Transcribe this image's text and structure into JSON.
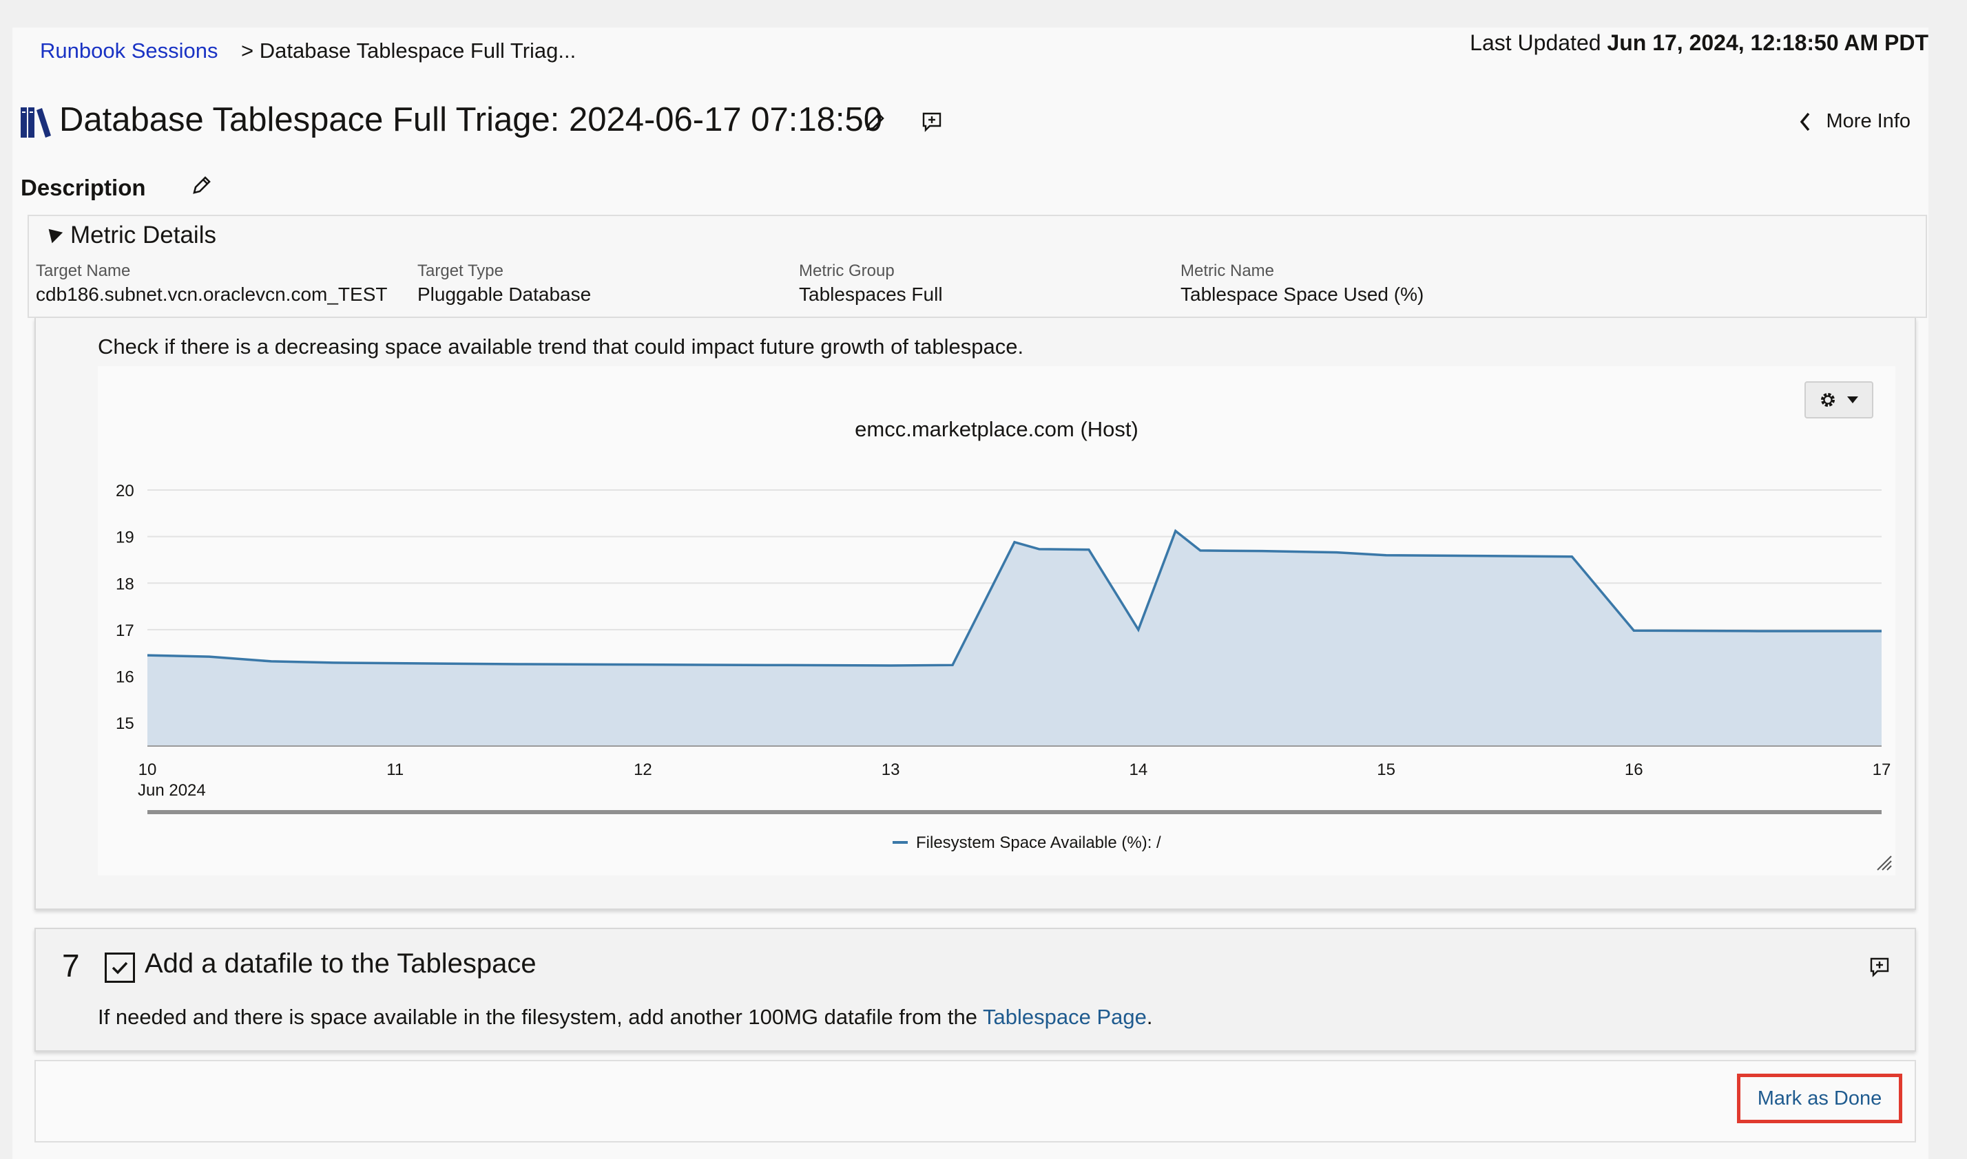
{
  "breadcrumb": {
    "link": "Runbook Sessions",
    "current": "> Database Tablespace Full Triag..."
  },
  "last_updated": {
    "label": "Last Updated",
    "value": "Jun 17, 2024, 12:18:50 AM PDT"
  },
  "header": {
    "title": "Database Tablespace Full Triage: 2024-06-17 07:18:50",
    "more_info": "More Info"
  },
  "description": {
    "label": "Description"
  },
  "metric_details": {
    "title": "Metric Details",
    "fields": [
      {
        "label": "Target Name",
        "value": "cdb186.subnet.vcn.oraclevcn.com_TEST"
      },
      {
        "label": "Target Type",
        "value": "Pluggable Database"
      },
      {
        "label": "Metric Group",
        "value": "Tablespaces Full"
      },
      {
        "label": "Metric Name",
        "value": "Tablespace Space Used (%)"
      }
    ]
  },
  "step6": {
    "instruction": "Check if there is a decreasing space available trend that could impact future growth of tablespace."
  },
  "chart_data": {
    "type": "area",
    "title": "emcc.marketplace.com (Host)",
    "xlabel": "",
    "ylabel": "",
    "x_ticks": [
      "10",
      "11",
      "12",
      "13",
      "14",
      "15",
      "16",
      "17"
    ],
    "x_sub_label": "Jun 2024",
    "xlim": [
      10,
      17
    ],
    "y_ticks": [
      15,
      16,
      17,
      18,
      19,
      20
    ],
    "ylim": [
      14.5,
      20
    ],
    "grid": true,
    "legend_position": "bottom",
    "color": "#3a78a8",
    "fill_color": "#d3dfeb",
    "series": [
      {
        "name": "Filesystem Space Available (%): /",
        "x": [
          10.0,
          10.25,
          10.5,
          10.75,
          11.0,
          11.5,
          12.0,
          12.5,
          13.0,
          13.25,
          13.5,
          13.6,
          13.8,
          14.0,
          14.15,
          14.25,
          14.5,
          14.8,
          15.0,
          15.5,
          15.75,
          16.0,
          16.5,
          17.0
        ],
        "y": [
          16.45,
          16.42,
          16.32,
          16.29,
          16.28,
          16.26,
          16.25,
          16.24,
          16.23,
          16.24,
          18.88,
          18.73,
          18.72,
          17.0,
          19.12,
          18.7,
          18.69,
          18.66,
          18.6,
          18.58,
          18.57,
          16.98,
          16.97,
          16.97
        ]
      }
    ]
  },
  "step7": {
    "number": "7",
    "title": "Add a datafile to the Tablespace",
    "desc_before": "If needed and there is space available in the filesystem, add another 100MG datafile from the ",
    "desc_link": "Tablespace Page",
    "desc_after": "."
  },
  "footer": {
    "mark_done": "Mark as Done"
  }
}
